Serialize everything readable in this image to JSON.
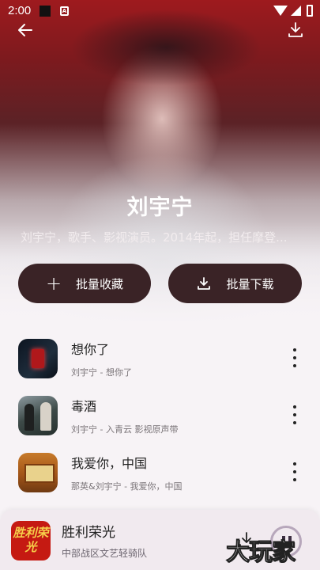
{
  "status_bar": {
    "time": "2:00",
    "notif_icon": "A"
  },
  "artist": {
    "name": "刘宇宁",
    "description": "刘宇宁，歌手、影视演员。2014年起，担任摩登..."
  },
  "actions": {
    "collect_label": "批量收藏",
    "download_label": "批量下载"
  },
  "songs": [
    {
      "title": "想你了",
      "subtitle": "刘宇宁 - 想你了"
    },
    {
      "title": "毒酒",
      "subtitle": "刘宇宁 - 入青云 影视原声带"
    },
    {
      "title": "我爱你，中国",
      "subtitle": "那英&刘宇宁 - 我爱你，中国"
    }
  ],
  "player": {
    "cover_text": "胜利荣光",
    "title": "胜利荣光",
    "subtitle": "中部战区文艺轻骑队"
  },
  "watermark": "大玩家",
  "colors": {
    "button_bg": "#3a2326",
    "hero_red": "#9e1a1e",
    "page_bg": "#f7f3f6"
  },
  "icons": [
    "back-arrow-icon",
    "download-icon",
    "plus-icon",
    "more-vertical-icon",
    "pause-icon"
  ]
}
